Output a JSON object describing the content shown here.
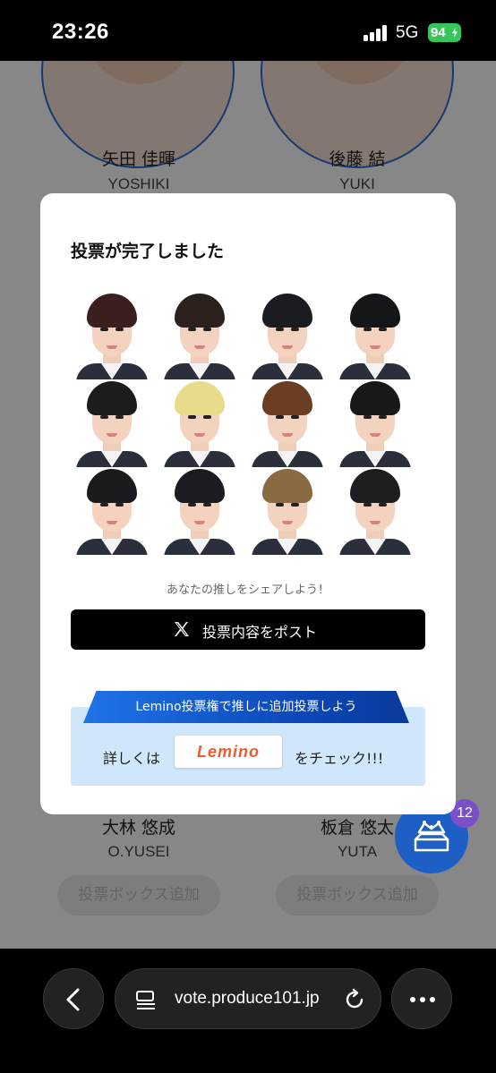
{
  "status_bar": {
    "time": "23:26",
    "network": "5G",
    "battery": "94"
  },
  "background": {
    "members_top": [
      {
        "name": "矢田 佳暉",
        "romaji": "YOSHIKI"
      },
      {
        "name": "後藤 結",
        "romaji": "YUKI"
      }
    ],
    "members_bottom": [
      {
        "name": "大林 悠成",
        "romaji": "O.YUSEI",
        "button": "投票ボックス追加"
      },
      {
        "name": "板倉 悠太",
        "romaji": "YUTA",
        "button": "投票ボックス追加"
      }
    ],
    "vote_box_count": "12"
  },
  "modal": {
    "title": "投票が完了しました",
    "portraits": [
      {
        "hair": "#3b1f1e"
      },
      {
        "hair": "#2a211d"
      },
      {
        "hair": "#1a1c22"
      },
      {
        "hair": "#15161a"
      },
      {
        "hair": "#1c1b1d"
      },
      {
        "hair": "#e8dc8a"
      },
      {
        "hair": "#6b3d22"
      },
      {
        "hair": "#18181b"
      },
      {
        "hair": "#1a1b1f"
      },
      {
        "hair": "#1b1c21"
      },
      {
        "hair": "#8a6a43"
      },
      {
        "hair": "#1d1e22"
      }
    ],
    "share_text": "あなたの推しをシェアしよう！",
    "post_button": "投票内容をポスト",
    "banner": {
      "ribbon": "Lemino投票権で推しに追加投票しよう",
      "prefix": "詳しくは",
      "logo": "Lemino",
      "suffix": "をチェック!!!"
    }
  },
  "browser": {
    "url": "vote.produce101.jp"
  }
}
